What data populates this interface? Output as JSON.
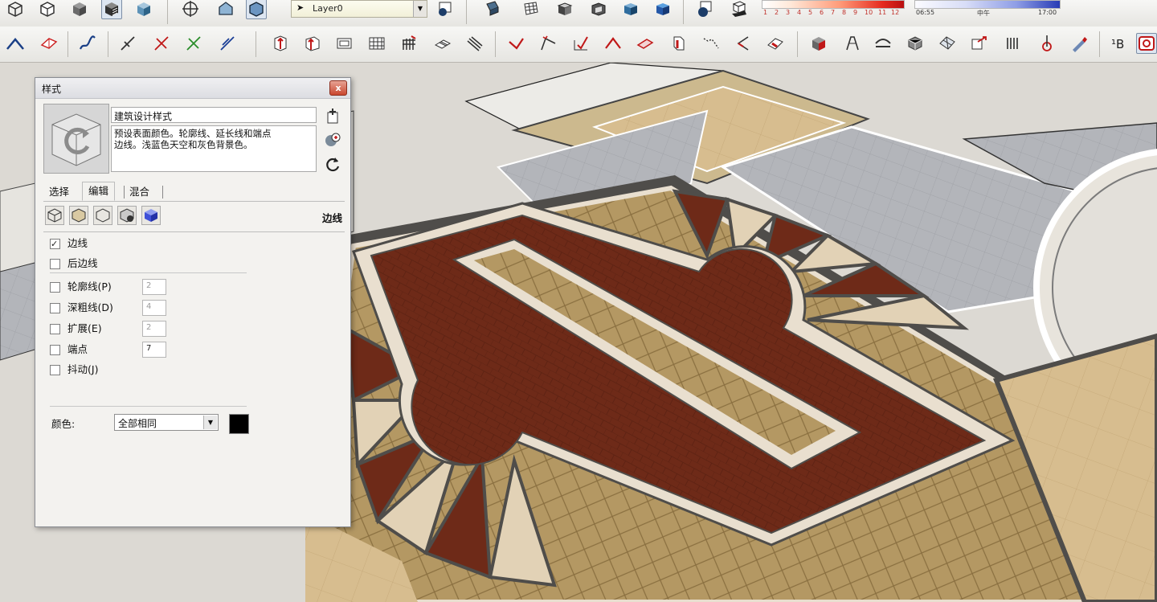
{
  "toolbar": {
    "layer_value": "Layer0",
    "shadow_scale": {
      "ticks": [
        "1",
        "2",
        "3",
        "4",
        "5",
        "6",
        "7",
        "8",
        "9",
        "10",
        "11",
        "12"
      ],
      "colors": {
        "start": "#ffffff",
        "end": "#b90f10"
      }
    },
    "time_scale": {
      "start_label": "06:55",
      "middle_label": "中午",
      "end_label": "17:00"
    }
  },
  "styles_panel": {
    "title": "样式",
    "close_label": "x",
    "style_name": "建筑设计样式",
    "style_description": "预设表面颜色。轮廓线、延长线和端点\n边线。浅蓝色天空和灰色背景色。",
    "tabs": [
      {
        "label": "选择",
        "active": false
      },
      {
        "label": "编辑",
        "active": true
      },
      {
        "label": "混合",
        "active": false
      }
    ],
    "section_label": "边线",
    "edges": {
      "edges_label": "边线",
      "edges_checked": true,
      "back_edges_label": "后边线",
      "back_edges_checked": false,
      "profiles_label": "轮廓线(P)",
      "profiles_value": "2",
      "depth_cue_label": "深粗线(D)",
      "depth_cue_value": "4",
      "extension_label": "扩展(E)",
      "extension_value": "2",
      "endpoints_label": "端点",
      "endpoints_value": "7",
      "jitter_label": "抖动(J)"
    },
    "color": {
      "label": "颜色:",
      "value": "全部相同",
      "swatch": "#000000"
    }
  },
  "colors": {
    "brick_red": "#6e2a18",
    "cream_border": "#e9dfcf",
    "tan_tile": "#ad8f5c",
    "dark_stone": "#4f4d4a",
    "gray_tile": "#b5b6ba",
    "sand": "#d7bd8f"
  }
}
